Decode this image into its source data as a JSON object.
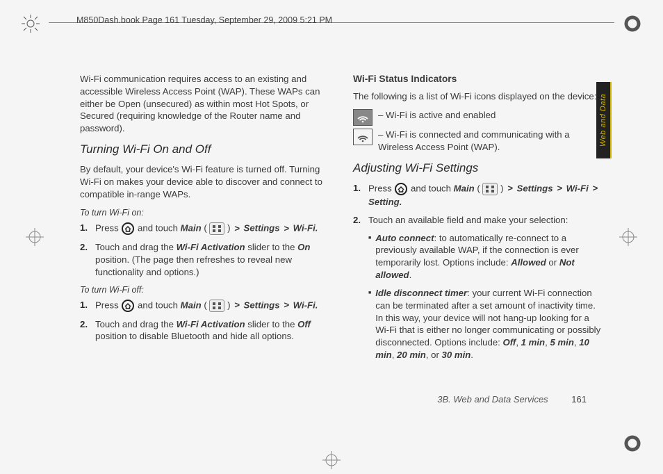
{
  "header": "M850Dash.book  Page 161  Tuesday, September 29, 2009  5:21 PM",
  "sideTab": "Web and Data",
  "footer": {
    "section": "3B. Web and Data Services",
    "page": "161"
  },
  "left": {
    "intro": "Wi-Fi communication requires access to an existing and accessible Wireless Access Point (WAP). These WAPs can either be Open (unsecured) as within most Hot Spots, or Secured (requiring knowledge of the Router name and password).",
    "h1": "Turning Wi-Fi On and Off",
    "p1": "By default, your device's Wi-Fi feature is turned off. Turning Wi-Fi on makes your device able to discover and connect to compatible in-range WAPs.",
    "onLabel": "To turn Wi-Fi on:",
    "on1a": "Press ",
    "on1b": " and touch ",
    "main": "Main",
    "settings": "Settings",
    "wifi": "Wi-Fi.",
    "on2a": "Touch and drag the ",
    "wfa": "Wi-Fi Activation",
    "on2b": " slider to the ",
    "onWord": "On",
    "on2c": " position. (The page then refreshes to reveal new functionality and options.)",
    "offLabel": "To turn Wi-Fi off:",
    "off2b": " slider to the ",
    "offWord": "Off",
    "off2c": " position to disable Bluetooth and hide all options."
  },
  "right": {
    "h1": "Wi-Fi Status Indicators",
    "p1": "The following is a list of Wi-Fi icons displayed on the device:",
    "s1": " – Wi-Fi is active and enabled",
    "s2": " – Wi-Fi is connected and communicating with a Wireless Access Point (WAP).",
    "h2": "Adjusting Wi-Fi Settings",
    "a1a": "Press ",
    "a1b": " and touch ",
    "wifiNoDot": "Wi-Fi",
    "setting": "Setting.",
    "a2": "Touch an available field and make your selection:",
    "b1t": "Auto connect",
    "b1": ": to automatically re-connect to a previously available WAP, if the connection is ever temporarily lost. Options include: ",
    "allowed": "Allowed",
    "or": " or ",
    "notallowed": "Not allowed",
    "b2t": "Idle disconnect timer",
    "b2a": ": your current Wi-Fi connection can be terminated after a set amount of inactivity time. In this way, your device will not hang-up looking for a Wi-Fi that is either no longer communicating or possibly disconnected. Options include: ",
    "opts": {
      "o1": "Off",
      "o2": "1 min",
      "o3": "5 min",
      "o4": "10 min",
      "o5": "20 min",
      "o6": "30 min"
    },
    "comma": ", ",
    "orPlain": ", or ",
    "period": "."
  },
  "gt": ">"
}
